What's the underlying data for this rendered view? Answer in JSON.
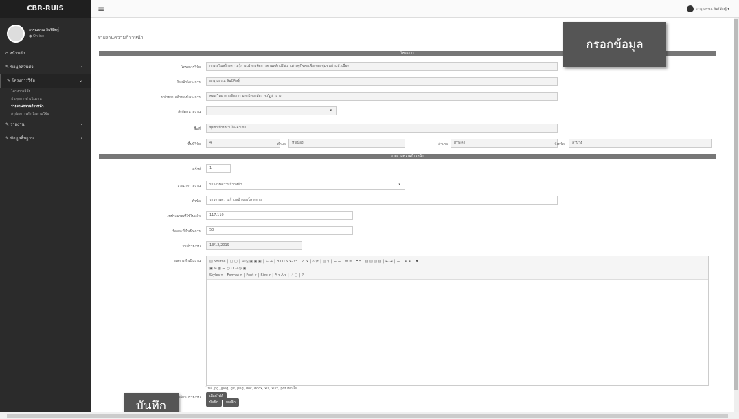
{
  "sidebar": {
    "brand": "CBR-RUIS",
    "user_name": "อารุณธรณ ลิมปิศิษฐ์",
    "user_status": "● Online",
    "menu": [
      {
        "label": "หน้าหลัก",
        "icon": "home-icon",
        "caret": ""
      },
      {
        "label": "ข้อมูลส่วนตัว",
        "icon": "edit-icon",
        "caret": "‹"
      },
      {
        "label": "โครงการวิจัย",
        "icon": "edit-icon",
        "caret": "⌄"
      }
    ],
    "submenu": [
      "โครงการวิจัย",
      "บันทุกการดำเนินงาน",
      "รายงานความก้าวหน้า",
      "สรุปผลการดำเนินงานวิจัย"
    ],
    "menu2": [
      {
        "label": "รายงาน",
        "icon": "edit-icon",
        "caret": "‹"
      },
      {
        "label": "ข้อมูลพื้นฐาน",
        "icon": "edit-icon",
        "caret": "‹"
      }
    ]
  },
  "topbar": {
    "user": "อารุณธรณ ลิมปิศิษฐ์ ▾"
  },
  "page": {
    "breadcrumb": "รายงานความก้าวหน้า",
    "band1": "โครงการ",
    "band2": "รายงานความก้าวหน้า"
  },
  "project": {
    "name_label": "โครงการวิจัย",
    "name": "การเสริมสร้างความรู้การบริหารจัดการตามหลักปรัชญาเศรษฐกิจพอเพียงของชุมชนบ้านหัวเมือง",
    "head_label": "หัวหน้าโครงการ",
    "head": "อารุณธรณ ลิมปิศิษฐ์",
    "org_label": "หน่วยงานเจ้าของโครงการ",
    "org": "คณะวิทยาการจัดการ มหาวิทยาลัยราชภัฏลำปาง",
    "type_label": "สังกัดหน่วยงาน",
    "area_label": "พื้นที่",
    "area": "ชุมชนบ้านหัวเมืองอำเภอ",
    "moo_label": "พื้นที่วิจัย",
    "moo": "4",
    "tambon_label": "ตำบล",
    "tambon": "หัวเมือง",
    "amphoe_label": "อำเภอ",
    "amphoe": "เกาะคา",
    "province_label": "จังหวัด",
    "province": "ลำปาง"
  },
  "report": {
    "no_label": "ครั้งที่",
    "no": "1",
    "type_label": "ประเภทรายงาน",
    "type": "รายงานความก้าวหน้า",
    "title_label": "หัวข้อ",
    "title": "รายงานความก้าวหน้าของโครงการ",
    "budget_label": "งบประมาณที่ใช้ไปแล้ว",
    "budget": "117,110",
    "percent_label": "ร้อยละที่ดำเนินการ",
    "percent": "50",
    "date_label": "วันที่รายงาน",
    "date": "13/12/2019",
    "detail_label": "ผลการดำเนินงาน",
    "toolbar_row1": "▤ Source │ ▢ ▢ │ ✂ ⎘ ▣ ▣ ▣ │ ← → │ B I U S x₂ x² │ ✓ Ix │ ⌕ ⇄ │ ▤ ¶ │ ☰ ☰ │ ≡ ≡ │ ❝ ❞ │ ▤ ▤ ▤ ▤ │ ⇤ ⇥ │ ☰ │ ⚭ ⚭ │ ⚑",
    "toolbar_row2": "▣ ⊘ ▦ ☰ ☺ Ω ⊣ ◷ ▣",
    "toolbar_row3": "Styles ▾ │ Format ▾ │ Font ▾ │ Size ▾ │ A ▾ A ▾ │ ⤢ ▢ │ ?",
    "attach_label": "ไฟล์แนบรายงาน",
    "attach_button": "เลือกไฟล์",
    "attach_note": "ไฟล์ jpg, jpeg, gif, png, doc, docx, xls, xlsx, pdf เท่านั้น",
    "save": "บันทึก",
    "cancel": "ยกเลิก"
  },
  "callouts": {
    "top": "กรอกข้อมูล",
    "bottom": "บันทึก"
  }
}
